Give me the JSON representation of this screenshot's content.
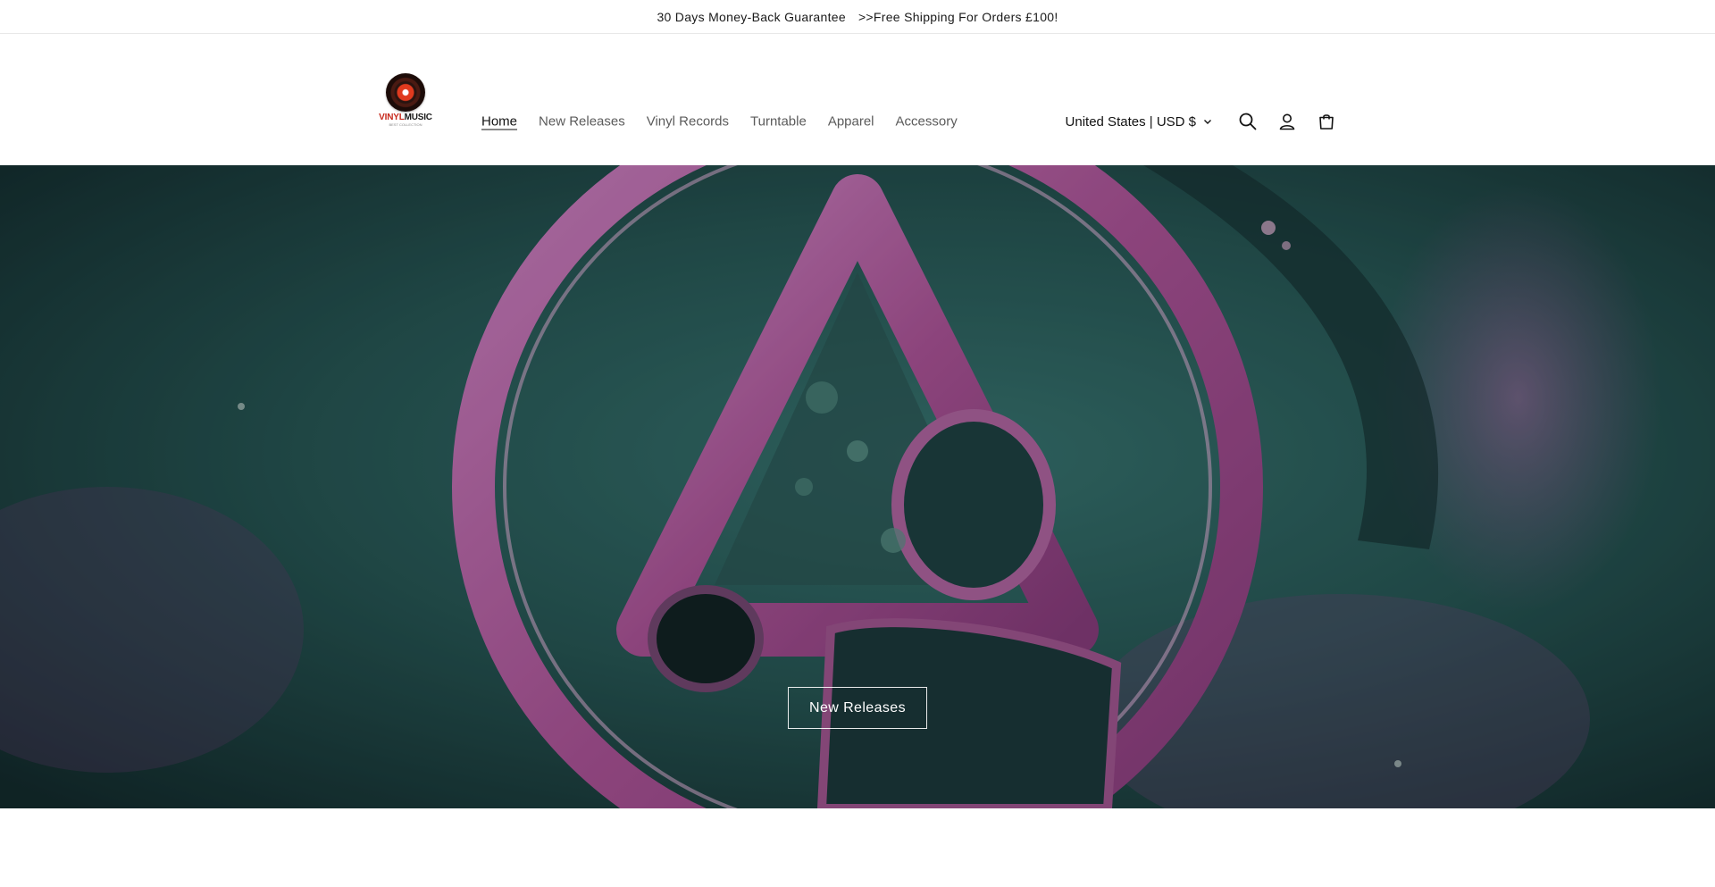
{
  "announcement": {
    "left_text": "30 Days Money-Back Guarantee",
    "right_text": ">>Free Shipping For Orders £100!"
  },
  "logo": {
    "brand_part1": "VINYL",
    "brand_part2": "MUSIC",
    "tagline": "BEST COLLECTION",
    "colors": {
      "red": "#c7281b",
      "dark": "#1a1a1a"
    }
  },
  "nav": {
    "items": [
      {
        "label": "Home",
        "active": true
      },
      {
        "label": "New Releases",
        "active": false
      },
      {
        "label": "Vinyl Records",
        "active": false
      },
      {
        "label": "Turntable",
        "active": false
      },
      {
        "label": "Apparel",
        "active": false
      },
      {
        "label": "Accessory",
        "active": false
      }
    ]
  },
  "header": {
    "localization": "United States | USD $",
    "icons": [
      "search-icon",
      "account-icon",
      "cart-icon"
    ]
  },
  "hero": {
    "button_label": "New Releases",
    "palette": {
      "teal": "#2f6a68",
      "pink": "#c05aa8",
      "dark": "#0f2426"
    }
  }
}
